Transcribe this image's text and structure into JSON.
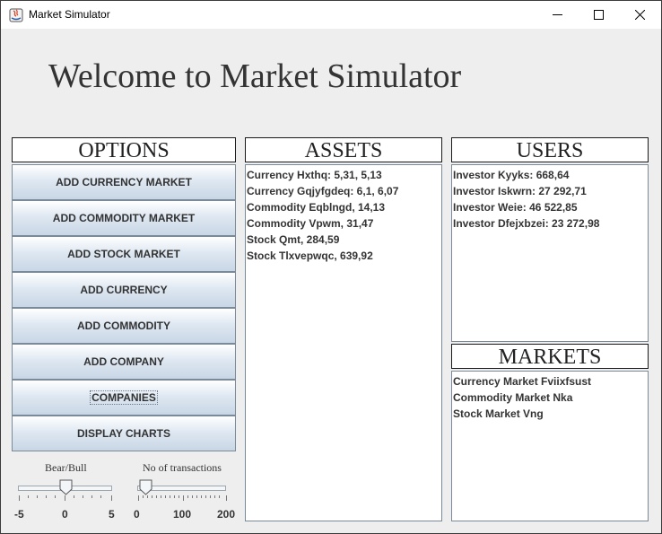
{
  "window": {
    "title": "Market Simulator"
  },
  "heading": "Welcome to Market Simulator",
  "options": {
    "title": "OPTIONS",
    "buttons": [
      "ADD CURRENCY MARKET",
      "ADD COMMODITY MARKET",
      "ADD STOCK MARKET",
      "ADD CURRENCY",
      "ADD COMMODITY",
      "ADD COMPANY",
      "COMPANIES",
      "DISPLAY CHARTS"
    ]
  },
  "assets": {
    "title": "ASSETS",
    "items": [
      "Currency Hxthq: 5,31, 5,13",
      "Currency Gqjyfgdeq: 6,1, 6,07",
      "Commodity Eqblngd, 14,13",
      "Commodity Vpwm, 31,47",
      "Stock Qmt, 284,59",
      "Stock Tlxvepwqc, 639,92"
    ]
  },
  "users": {
    "title": "USERS",
    "items": [
      "Investor Kyyks: 668,64",
      "Investor Iskwrn: 27 292,71",
      "Investor Weie: 46 522,85",
      "Investor Dfejxbzei: 23 272,98"
    ]
  },
  "markets": {
    "title": "MARKETS",
    "items": [
      "Currency Market Fviixfsust",
      "Commodity Market Nka",
      "Stock Market Vng"
    ]
  },
  "sliders": {
    "bear_bull": {
      "label": "Bear/Bull",
      "min_label": "-5",
      "mid_label": "0",
      "max_label": "5",
      "min": -5,
      "max": 5,
      "value": 0
    },
    "transactions": {
      "label": "No of transactions",
      "min_label": "0",
      "mid_label": "100",
      "max_label": "200",
      "min": 0,
      "max": 200,
      "value": 0
    }
  }
}
